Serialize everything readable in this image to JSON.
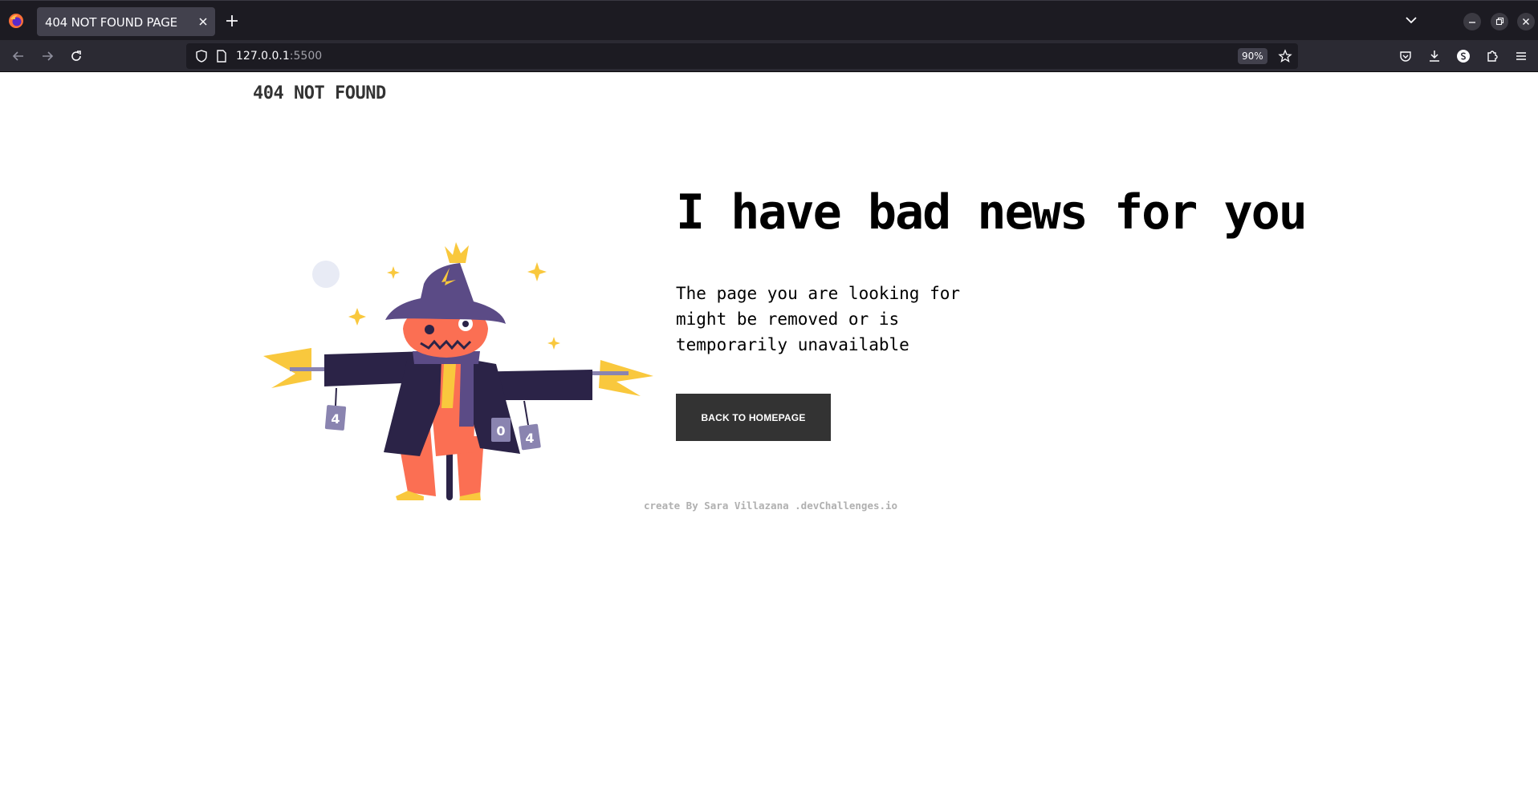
{
  "browser": {
    "tab_title": "404 NOT FOUND PAGE",
    "url_host": "127.0.0.1",
    "url_port": ":5500",
    "zoom": "90%"
  },
  "page": {
    "brand": "404 NOT FOUND",
    "headline": "I have bad news for you",
    "message": "The page you are looking for might be removed or is temporarily unavailable",
    "cta_label": "BACK TO HOMEPAGE",
    "credit": "create By Sara Villazana .devChallenges.io"
  },
  "illustration": {
    "can_digits": [
      "4",
      "0",
      "4"
    ]
  },
  "colors": {
    "button_bg": "#333333",
    "coat": "#2b2347",
    "hat": "#5b4b86",
    "face": "#fb6f53",
    "straw": "#f9c83d",
    "credit_text": "#b0b0b0"
  }
}
